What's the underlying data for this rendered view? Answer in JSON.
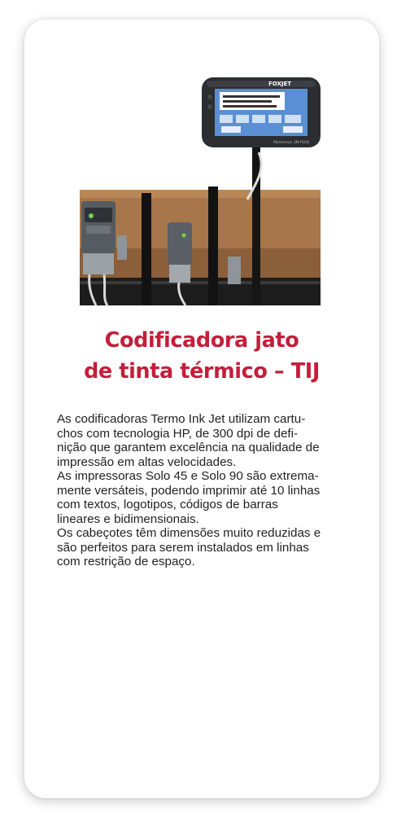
{
  "product": {
    "brand": "FOXJET",
    "device_model": "Marksman 3M PLUS",
    "title_line1": "Codificadora jato",
    "title_line2": "de tinta térmico – TIJ",
    "description_lines": [
      "As codificadoras Termo Ink Jet utilizam cartu-",
      "chos com tecnologia HP, de 300 dpi de defi-",
      "nição que garantem excelência na qualidade de",
      "impressão em altas velocidades.",
      "As impressoras Solo 45 e Solo 90 são extrema-",
      "mente versáteis, podendo imprimir até 10 linhas",
      "com textos, logotipos, códigos de barras",
      "lineares e bidimensionais.",
      "Os cabeçotes têm dimensões muito reduzidas e",
      "são perfeitos para serem instalados em linhas",
      "com restrição de espaço."
    ]
  },
  "colors": {
    "title": "#c41e3a",
    "text": "#222222",
    "card_background": "#ffffff"
  }
}
